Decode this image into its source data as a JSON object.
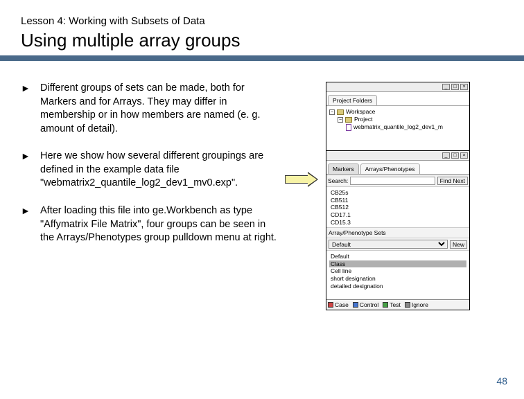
{
  "lesson_label": "Lesson 4: Working with Subsets of Data",
  "title": "Using multiple array groups",
  "bullets": [
    "Different groups of sets can be made, both for Markers and for Arrays. They may differ in membership or in how members are named (e. g. amount of detail).",
    "Here we show how several different groupings are defined in the example data file \"webmatrix2_quantile_log2_dev1_mv0.exp\".",
    "After  loading this file into ge.Workbench as type \"Affymatrix File Matrix\", four groups can be seen in the Arrays/Phenotypes group pulldown menu at right."
  ],
  "panels": {
    "project": {
      "tab": "Project Folders",
      "rows": [
        {
          "icon": "folder",
          "label": "Workspace"
        },
        {
          "icon": "folder",
          "label": "Project",
          "indent": 1
        },
        {
          "icon": "file",
          "label": "webmatrix_quantile_log2_dev1_m",
          "indent": 2
        }
      ]
    },
    "markers": {
      "tab_front": "Markers",
      "tab_back": "Arrays/Phenotypes",
      "search_label": "Search:",
      "find_next": "Find Next",
      "items": [
        "CB25s",
        "CB511",
        "CB512",
        "CD17.1",
        "CD15.3"
      ],
      "sets_label": "Array/Phenotype Sets",
      "sets_select": "Default",
      "sets_new": "New",
      "groups": [
        "Default",
        "Class",
        "Cell line",
        "short designation",
        "detailed designation"
      ],
      "selected_group_index": 1
    },
    "bottom": {
      "case": "Case",
      "control": "Control",
      "test": "Test",
      "ignore": "Ignore"
    }
  },
  "page_number": "48"
}
